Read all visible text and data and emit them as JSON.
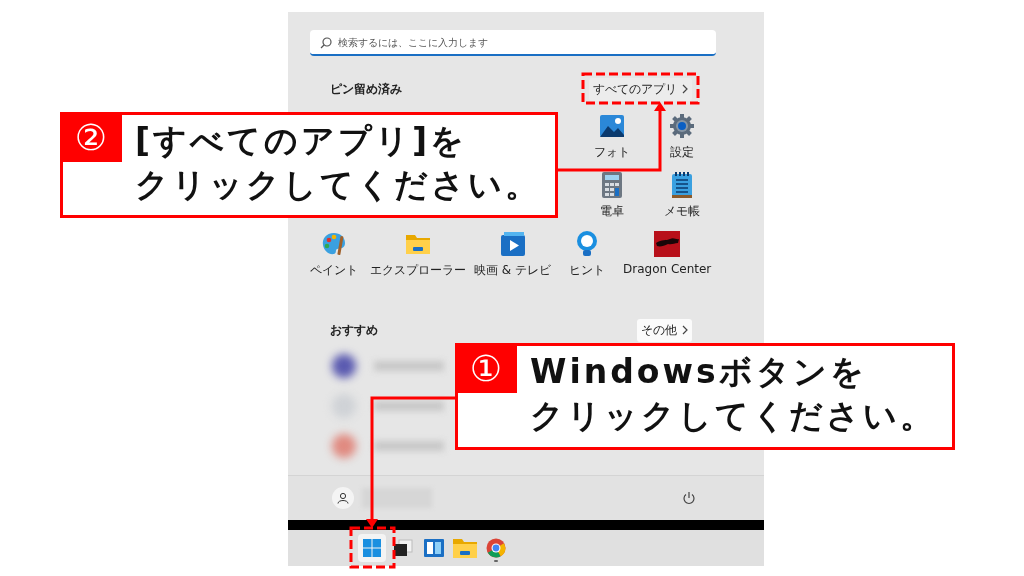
{
  "start_menu": {
    "search": {
      "placeholder": "検索するには、ここに入力します"
    },
    "pinned": {
      "title": "ピン留め済み",
      "all_apps_button": "すべてのアプリ",
      "rows": [
        [
          {
            "label": "フォト",
            "kind": "photo"
          },
          {
            "label": "設定",
            "kind": "gear"
          }
        ],
        [
          {
            "label": "電卓",
            "kind": "calculator"
          },
          {
            "label": "メモ帳",
            "kind": "notepad"
          }
        ],
        [
          {
            "label": "ペイント",
            "kind": "palette"
          },
          {
            "label": "エクスプローラー",
            "kind": "folder"
          },
          {
            "label": "映画 & テレビ",
            "kind": "play"
          },
          {
            "label": "ヒント",
            "kind": "bulb"
          },
          {
            "label": "Dragon Center",
            "kind": "dragon"
          }
        ]
      ]
    },
    "recommended": {
      "title": "おすすめ",
      "more_button": "その他"
    }
  },
  "taskbar": {
    "items": [
      {
        "kind": "windows",
        "selected": true,
        "running": false
      },
      {
        "kind": "taskview",
        "selected": false,
        "running": false
      },
      {
        "kind": "widgets",
        "selected": false,
        "running": false
      },
      {
        "kind": "folder",
        "selected": false,
        "running": false
      },
      {
        "kind": "browser",
        "selected": false,
        "running": true
      }
    ]
  },
  "callouts": [
    {
      "number": "②",
      "lines": [
        "[すべてのアプリ]を",
        "クリックしてください。"
      ]
    },
    {
      "number": "①",
      "lines": [
        "Windowsボタンを",
        "クリックしてください。"
      ]
    }
  ]
}
